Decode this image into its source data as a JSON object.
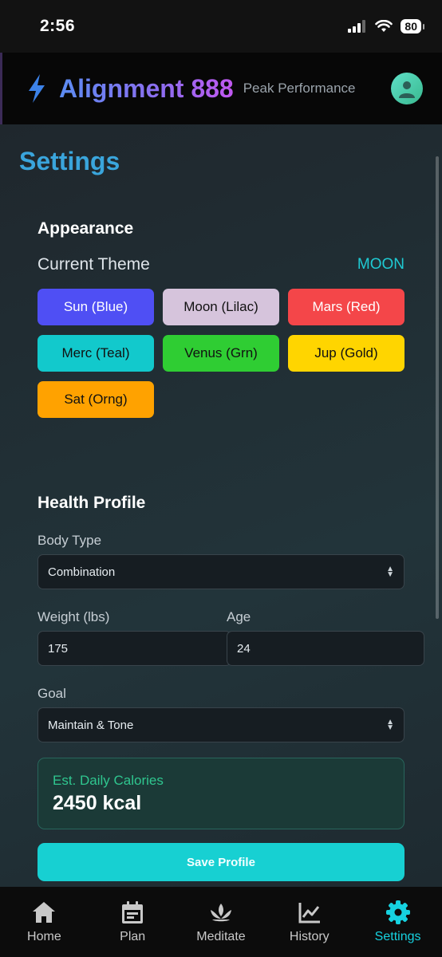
{
  "status_bar": {
    "time": "2:56",
    "battery": "80"
  },
  "header": {
    "title": "Alignment 888",
    "subtitle": "Peak Performance"
  },
  "page": {
    "title": "Settings"
  },
  "appearance": {
    "section_title": "Appearance",
    "current_theme_label": "Current Theme",
    "current_theme_value": "MOON",
    "themes": [
      {
        "label": "Sun (Blue)",
        "color": "#4f4ff4",
        "text_color": "#ffffff"
      },
      {
        "label": "Moon (Lilac)",
        "color": "#d6c4dc",
        "text_color": "#111111"
      },
      {
        "label": "Mars (Red)",
        "color": "#f44649",
        "text_color": "#ffffff"
      },
      {
        "label": "Merc (Teal)",
        "color": "#12c9cc",
        "text_color": "#111111"
      },
      {
        "label": "Venus (Grn)",
        "color": "#2fcd33",
        "text_color": "#111111"
      },
      {
        "label": "Jup (Gold)",
        "color": "#ffd500",
        "text_color": "#111111"
      },
      {
        "label": "Sat (Orng)",
        "color": "#ffa200",
        "text_color": "#111111"
      }
    ]
  },
  "health": {
    "section_title": "Health Profile",
    "body_type_label": "Body Type",
    "body_type_value": "Combination",
    "weight_label": "Weight (lbs)",
    "weight_value": "175",
    "age_label": "Age",
    "age_value": "24",
    "goal_label": "Goal",
    "goal_value": "Maintain & Tone",
    "calories_label": "Est. Daily Calories",
    "calories_value": "2450 kcal",
    "save_label": "Save Profile"
  },
  "nav": {
    "items": [
      {
        "label": "Home",
        "icon": "home-icon"
      },
      {
        "label": "Plan",
        "icon": "calendar-icon"
      },
      {
        "label": "Meditate",
        "icon": "lotus-icon"
      },
      {
        "label": "History",
        "icon": "chart-icon"
      },
      {
        "label": "Settings",
        "icon": "gear-icon"
      }
    ],
    "active": "Settings",
    "active_color": "#16d2e0"
  }
}
